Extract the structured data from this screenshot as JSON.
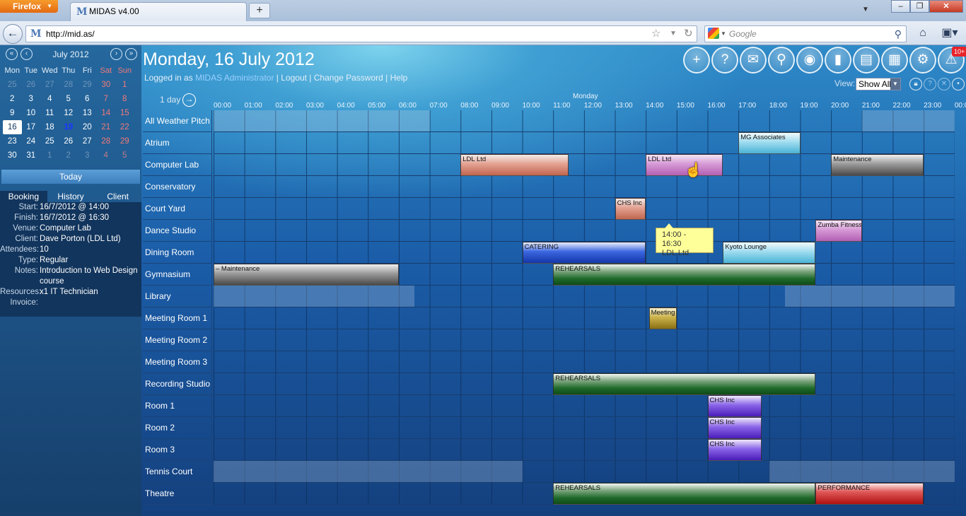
{
  "browser": {
    "firefox_label": "Firefox",
    "tab_title": "MIDAS v4.00",
    "url": "http://mid.as/",
    "search_placeholder": "Google"
  },
  "header": {
    "date_title": "Monday, 16 July 2012",
    "logged_in_label": "Logged in as",
    "user": "MIDAS Administrator",
    "logout": "Logout",
    "change_password": "Change Password",
    "help": "Help",
    "badge": "10+",
    "view_label": "View:",
    "view_value": "Show All",
    "day_span": "1 day",
    "day_name": "Monday"
  },
  "calendar": {
    "month": "July 2012",
    "weekdays": [
      "Mon",
      "Tue",
      "Wed",
      "Thu",
      "Fri",
      "Sat",
      "Sun"
    ],
    "weeks": [
      [
        [
          "25",
          1
        ],
        [
          "26",
          1
        ],
        [
          "27",
          1
        ],
        [
          "28",
          1
        ],
        [
          "29",
          1
        ],
        [
          "30",
          0
        ],
        [
          "1",
          0
        ]
      ],
      [
        [
          "2",
          0
        ],
        [
          "3",
          0
        ],
        [
          "4",
          0
        ],
        [
          "5",
          0
        ],
        [
          "6",
          0
        ],
        [
          "7",
          0
        ],
        [
          "8",
          0
        ]
      ],
      [
        [
          "9",
          0
        ],
        [
          "10",
          0
        ],
        [
          "11",
          0
        ],
        [
          "12",
          0
        ],
        [
          "13",
          0
        ],
        [
          "14",
          0
        ],
        [
          "15",
          0
        ]
      ],
      [
        [
          "16",
          0
        ],
        [
          "17",
          0
        ],
        [
          "18",
          0
        ],
        [
          "19",
          0
        ],
        [
          "20",
          0
        ],
        [
          "21",
          0
        ],
        [
          "22",
          0
        ]
      ],
      [
        [
          "23",
          0
        ],
        [
          "24",
          0
        ],
        [
          "25",
          0
        ],
        [
          "26",
          0
        ],
        [
          "27",
          0
        ],
        [
          "28",
          0
        ],
        [
          "29",
          0
        ]
      ],
      [
        [
          "30",
          0
        ],
        [
          "31",
          0
        ],
        [
          "1",
          1
        ],
        [
          "2",
          1
        ],
        [
          "3",
          1
        ],
        [
          "4",
          1
        ],
        [
          "5",
          1
        ]
      ]
    ],
    "selected_day": "16",
    "current_day": "19",
    "today_label": "Today"
  },
  "info_panel": {
    "tabs": [
      "Booking",
      "History",
      "Client"
    ],
    "active_tab": "Booking",
    "fields": [
      {
        "k": "Start:",
        "v": "16/7/2012 @ 14:00"
      },
      {
        "k": "Finish:",
        "v": "16/7/2012 @ 16:30"
      },
      {
        "k": "Venue:",
        "v": "Computer Lab"
      },
      {
        "k": "Client:",
        "v": "Dave Porton (LDL Ltd)"
      },
      {
        "k": "Attendees:",
        "v": "10"
      },
      {
        "k": "Type:",
        "v": "Regular"
      },
      {
        "k": "Notes:",
        "v": "Introduction to Web Design course"
      },
      {
        "k": "Resources:",
        "v": "x1 IT Technician"
      },
      {
        "k": "Invoice:",
        "v": ""
      }
    ]
  },
  "hours": [
    "00:00",
    "01:00",
    "02:00",
    "03:00",
    "04:00",
    "05:00",
    "06:00",
    "07:00",
    "08:00",
    "09:00",
    "10:00",
    "11:00",
    "12:00",
    "13:00",
    "14:00",
    "15:00",
    "16:00",
    "17:00",
    "18:00",
    "19:00",
    "20:00",
    "21:00",
    "22:00",
    "23:00",
    "00:00"
  ],
  "venues": [
    {
      "name": "All Weather Pitch",
      "unavailable": [
        [
          0,
          7
        ],
        [
          21,
          24
        ]
      ],
      "bookings": []
    },
    {
      "name": "Atrium",
      "unavailable": [],
      "bookings": [
        {
          "label": "MG Associates",
          "start": 17.0,
          "end": 19.0,
          "color": "cyan"
        }
      ]
    },
    {
      "name": "Computer Lab",
      "unavailable": [],
      "bookings": [
        {
          "label": "LDL Ltd",
          "start": 8.0,
          "end": 11.5,
          "color": "salmon"
        },
        {
          "label": "LDL Ltd",
          "start": 14.0,
          "end": 16.5,
          "color": "pink"
        },
        {
          "label": "Maintenance",
          "start": 20.0,
          "end": 23.0,
          "color": "gray"
        }
      ]
    },
    {
      "name": "Conservatory",
      "unavailable": [],
      "bookings": []
    },
    {
      "name": "Court Yard",
      "unavailable": [],
      "bookings": [
        {
          "label": "CHS Inc",
          "start": 13.0,
          "end": 14.0,
          "color": "salmon"
        }
      ]
    },
    {
      "name": "Dance Studio",
      "unavailable": [],
      "bookings": [
        {
          "label": "Zumba Fitness",
          "start": 19.5,
          "end": 21.0,
          "color": "pink"
        }
      ]
    },
    {
      "name": "Dining Room",
      "unavailable": [],
      "bookings": [
        {
          "label": "CATERING",
          "start": 10.0,
          "end": 14.0,
          "color": "blue"
        },
        {
          "label": "Kyoto Lounge",
          "start": 16.5,
          "end": 19.5,
          "color": "cyan"
        }
      ]
    },
    {
      "name": "Gymnasium",
      "unavailable": [],
      "bookings": [
        {
          "label": "– Maintenance",
          "start": 0.0,
          "end": 6.0,
          "color": "gray"
        },
        {
          "label": "REHEARSALS",
          "start": 11.0,
          "end": 19.5,
          "color": "green"
        }
      ]
    },
    {
      "name": "Library",
      "unavailable": [
        [
          0,
          6.5
        ],
        [
          18.5,
          24
        ]
      ],
      "bookings": []
    },
    {
      "name": "Meeting Room 1",
      "unavailable": [],
      "bookings": [
        {
          "label": "Meeting",
          "start": 14.1,
          "end": 15.0,
          "color": "gold"
        }
      ]
    },
    {
      "name": "Meeting Room 2",
      "unavailable": [],
      "bookings": []
    },
    {
      "name": "Meeting Room 3",
      "unavailable": [],
      "bookings": []
    },
    {
      "name": "Recording Studio",
      "unavailable": [],
      "bookings": [
        {
          "label": "REHEARSALS",
          "start": 11.0,
          "end": 19.5,
          "color": "green"
        }
      ]
    },
    {
      "name": "Room 1",
      "unavailable": [],
      "bookings": [
        {
          "label": "CHS Inc",
          "start": 16.0,
          "end": 17.75,
          "color": "purple"
        }
      ]
    },
    {
      "name": "Room 2",
      "unavailable": [],
      "bookings": [
        {
          "label": "CHS Inc",
          "start": 16.0,
          "end": 17.75,
          "color": "purple"
        }
      ]
    },
    {
      "name": "Room 3",
      "unavailable": [],
      "bookings": [
        {
          "label": "CHS Inc",
          "start": 16.0,
          "end": 17.75,
          "color": "purple"
        }
      ]
    },
    {
      "name": "Tennis Court",
      "unavailable": [
        [
          0,
          10
        ],
        [
          18,
          24
        ]
      ],
      "bookings": []
    },
    {
      "name": "Theatre",
      "unavailable": [],
      "bookings": [
        {
          "label": "REHEARSALS",
          "start": 11.0,
          "end": 19.5,
          "color": "green"
        },
        {
          "label": "PERFORMANCE",
          "start": 19.5,
          "end": 23.0,
          "color": "red"
        }
      ]
    }
  ],
  "tooltip": {
    "time": "14:00 - 16:30",
    "client": "LDL Ltd"
  },
  "toolbar_icons": [
    "add-icon",
    "help-icon",
    "mail-icon",
    "search-icon",
    "view-icon",
    "reports-icon",
    "print-icon",
    "calculator-icon",
    "settings-icon",
    "alerts-icon"
  ]
}
